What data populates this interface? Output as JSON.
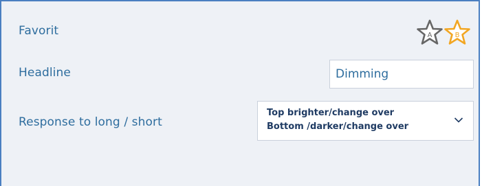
{
  "form": {
    "favorite": {
      "label": "Favorit",
      "stars": [
        {
          "letter": "A",
          "icon": "star-outline-icon",
          "color": "#666666"
        },
        {
          "letter": "B",
          "icon": "star-outline-icon",
          "color": "#f2a622"
        }
      ]
    },
    "headline": {
      "label": "Headline",
      "value": "Dimming"
    },
    "response": {
      "label": "Response to long / short",
      "selected_line1": "Top brighter/change over",
      "selected_line2": "Bottom /darker/change over"
    }
  }
}
